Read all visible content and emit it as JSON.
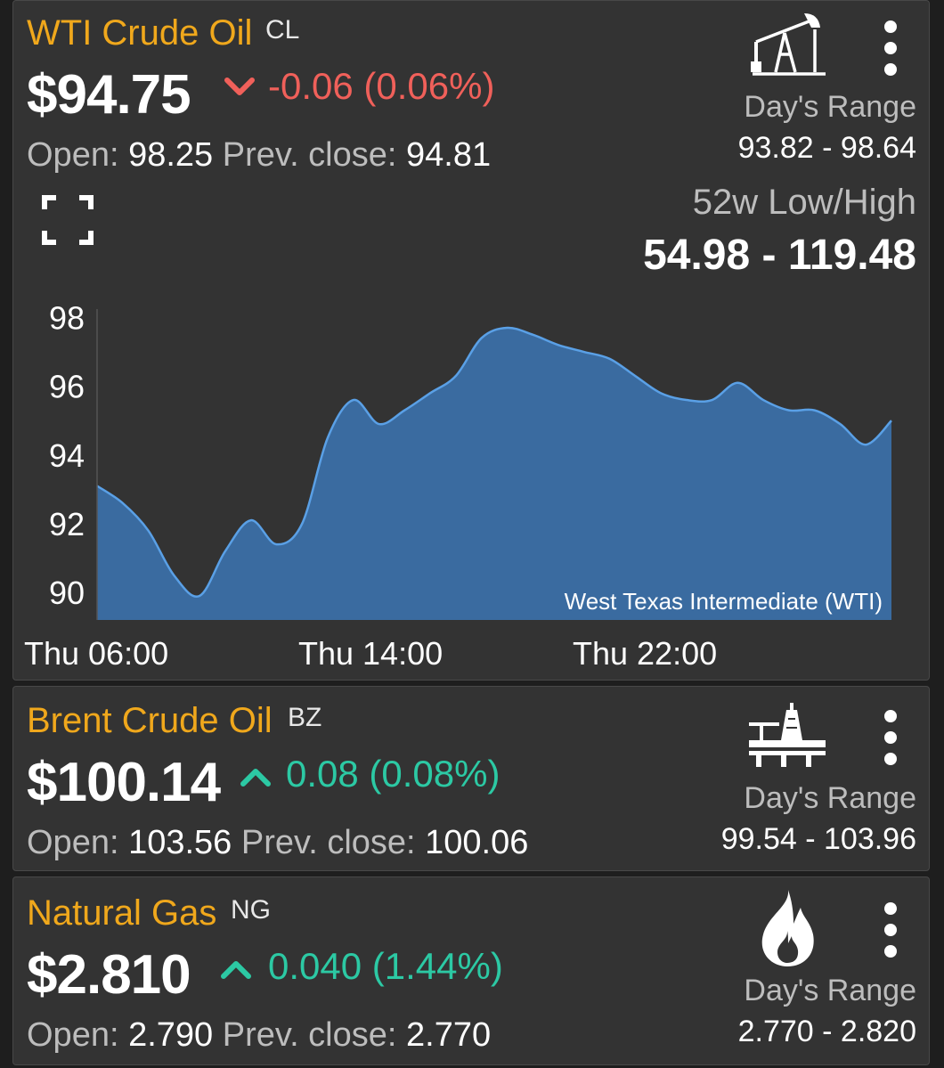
{
  "wti": {
    "name": "WTI Crude Oil",
    "symbol": "CL",
    "price": "$94.75",
    "change": "-0.06 (0.06%)",
    "direction": "down",
    "open_label": "Open:",
    "open": "98.25",
    "prev_close_label": "Prev. close:",
    "prev_close": "94.81",
    "days_range_label": "Day's Range",
    "days_range": "93.82 - 98.64",
    "wk52_label": "52w Low/High",
    "wk52": "54.98 - 119.48",
    "icon": "oil-pumpjack-icon"
  },
  "chart_data": {
    "type": "area",
    "series_label": "West Texas Intermediate (WTI)",
    "xlabels": [
      "Thu 06:00",
      "Thu 14:00",
      "Thu 22:00"
    ],
    "yticks": [
      90,
      92,
      94,
      96,
      98
    ],
    "ylim": [
      89.2,
      98.4
    ],
    "color": "#3a6ba0",
    "line_color": "#5aa0e6",
    "x": [
      0,
      1,
      2,
      3,
      4,
      5,
      6,
      7,
      8,
      9,
      10,
      11,
      12,
      13,
      14,
      15,
      16,
      17,
      18,
      19,
      20,
      21,
      22,
      23,
      24,
      25,
      26,
      27,
      28,
      29,
      30,
      31
    ],
    "values": [
      93.1,
      92.6,
      91.8,
      90.5,
      89.9,
      91.2,
      92.1,
      91.4,
      92.0,
      94.5,
      95.6,
      94.9,
      95.3,
      95.8,
      96.3,
      97.4,
      97.7,
      97.5,
      97.2,
      97.0,
      96.8,
      96.3,
      95.8,
      95.6,
      95.6,
      96.1,
      95.6,
      95.3,
      95.3,
      94.9,
      94.3,
      95.0
    ]
  },
  "brent": {
    "name": "Brent Crude Oil",
    "symbol": "BZ",
    "price": "$100.14",
    "change": "0.08 (0.08%)",
    "direction": "up",
    "open_label": "Open:",
    "open": "103.56",
    "prev_close_label": "Prev. close:",
    "prev_close": "100.06",
    "days_range_label": "Day's Range",
    "days_range": "99.54 - 103.96",
    "icon": "offshore-rig-icon"
  },
  "gas": {
    "name": "Natural Gas",
    "symbol": "NG",
    "price": "$2.810",
    "change": "0.040 (1.44%)",
    "direction": "up",
    "open_label": "Open:",
    "open": "2.790",
    "prev_close_label": "Prev. close:",
    "prev_close": "2.770",
    "days_range_label": "Day's Range",
    "days_range": "2.770 - 2.820",
    "icon": "flame-icon"
  },
  "colors": {
    "accent": "#f0a81c",
    "down": "#f0605a",
    "up": "#2cc9a4",
    "card": "#333333"
  }
}
